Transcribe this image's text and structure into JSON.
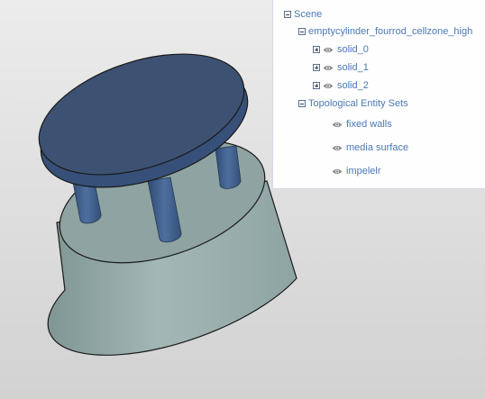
{
  "tree": {
    "scene": {
      "label": "Scene",
      "icon": "minus-toggle-icon"
    },
    "model": {
      "label": "emptycylinder_fourrod_cellzone_high",
      "icon": "minus-toggle-icon"
    },
    "solids": [
      {
        "label": "solid_0",
        "icon": "plus-toggle-icon"
      },
      {
        "label": "solid_1",
        "icon": "plus-toggle-icon"
      },
      {
        "label": "solid_2",
        "icon": "plus-toggle-icon"
      }
    ],
    "sets": {
      "label": "Topological Entity Sets",
      "icon": "minus-toggle-icon"
    },
    "entities": [
      {
        "label": "fixed walls",
        "icon": "eye-icon"
      },
      {
        "label": "media surface",
        "icon": "eye-icon"
      },
      {
        "label": "impelelr",
        "icon": "eye-icon"
      }
    ]
  },
  "colors": {
    "link": "#4a78b5",
    "disc_top": "#3d5273",
    "rod": "#44638f",
    "cylinder": "#93a8a7"
  }
}
